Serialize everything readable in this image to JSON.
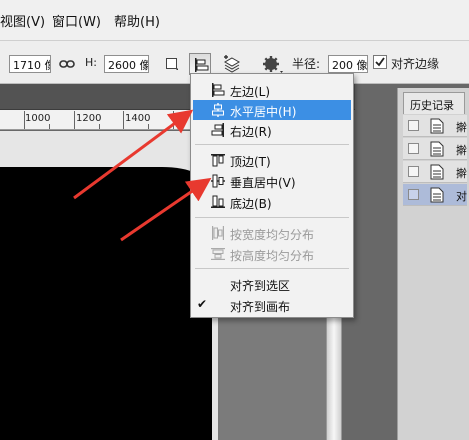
{
  "menubar": {
    "items": [
      "视图(V)",
      "窗口(W)",
      "帮助(H)"
    ]
  },
  "options": {
    "w_value": "1710 像",
    "link_icon": "link-icon",
    "h_label": "H:",
    "h_value": "2600 像",
    "radius_label": "半径:",
    "radius_value": "200 像",
    "align_edges_label": "对齐边缘",
    "align_edges_checked": true
  },
  "ruler": {
    "labels": [
      "1000",
      "1200",
      "1400"
    ]
  },
  "history": {
    "tab": "历史记录",
    "rows": [
      "擀",
      "擀",
      "擀",
      "对"
    ],
    "selected_index": 3
  },
  "align_menu": {
    "items": [
      {
        "label": "左边(L)",
        "icon": "align-left-icon",
        "enabled": true
      },
      {
        "label": "水平居中(H)",
        "icon": "align-horizontal-center-icon",
        "enabled": true,
        "highlighted": true
      },
      {
        "label": "右边(R)",
        "icon": "align-right-icon",
        "enabled": true
      },
      {
        "label": "顶边(T)",
        "icon": "align-top-icon",
        "enabled": true
      },
      {
        "label": "垂直居中(V)",
        "icon": "align-vertical-center-icon",
        "enabled": true
      },
      {
        "label": "底边(B)",
        "icon": "align-bottom-icon",
        "enabled": true
      },
      {
        "label": "按宽度均匀分布",
        "icon": "distribute-width-icon",
        "enabled": false
      },
      {
        "label": "按高度均匀分布",
        "icon": "distribute-height-icon",
        "enabled": false
      },
      {
        "label": "对齐到选区",
        "enabled": true
      },
      {
        "label": "对齐到画布",
        "enabled": true,
        "checked": true
      }
    ]
  },
  "colors": {
    "menu_highlight": "#3c8fe4",
    "arrow": "#e8392f",
    "workspace": "#686868"
  }
}
